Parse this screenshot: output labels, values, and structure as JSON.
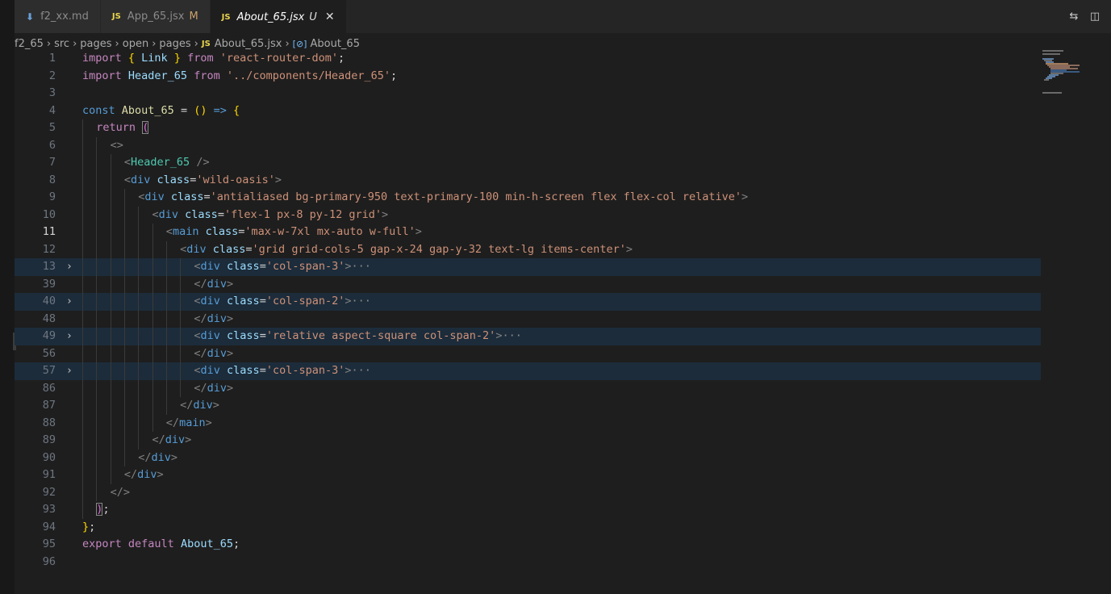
{
  "tabs": [
    {
      "icon": "markdown-file-icon",
      "glyph": "⬇",
      "label": "f2_xx.md",
      "status": "",
      "active": false
    },
    {
      "icon": "js-file-icon",
      "glyph": "JS",
      "label": "App_65.jsx",
      "status": "M",
      "active": false
    },
    {
      "icon": "js-file-icon",
      "glyph": "JS",
      "label": "About_65.jsx",
      "status": "U",
      "active": true,
      "close": "✕"
    }
  ],
  "actions": [
    {
      "icon": "compare-changes-icon",
      "glyph": "⇆"
    },
    {
      "icon": "split-editor-icon",
      "glyph": "◫"
    }
  ],
  "breadcrumb": {
    "separator": "›",
    "folders": [
      "f2_65",
      "src",
      "pages",
      "open",
      "pages"
    ],
    "file_icon": "JS",
    "file": "About_65.jsx",
    "symbol_icon": "[⊘]",
    "symbol": "About_65"
  },
  "editor": {
    "current_line": "11",
    "lines": [
      {
        "n": "1",
        "indent": 0,
        "fold": false,
        "tokens": [
          [
            "kw2",
            "import "
          ],
          [
            "br1",
            "{ "
          ],
          [
            "var",
            "Link"
          ],
          [
            "br1",
            " }"
          ],
          [
            "kw2",
            " from "
          ],
          [
            "str",
            "'react-router-dom'"
          ],
          [
            "punc",
            ";"
          ]
        ]
      },
      {
        "n": "2",
        "indent": 0,
        "fold": false,
        "tokens": [
          [
            "kw2",
            "import "
          ],
          [
            "var",
            "Header_65"
          ],
          [
            "kw2",
            " from "
          ],
          [
            "str",
            "'../components/Header_65'"
          ],
          [
            "punc",
            ";"
          ]
        ]
      },
      {
        "n": "3",
        "indent": 0,
        "fold": false,
        "tokens": []
      },
      {
        "n": "4",
        "indent": 0,
        "fold": false,
        "tokens": [
          [
            "kw",
            "const "
          ],
          [
            "fn",
            "About_65"
          ],
          [
            "punc",
            " = "
          ],
          [
            "br1",
            "()"
          ],
          [
            "kw",
            " => "
          ],
          [
            "br1",
            "{"
          ]
        ]
      },
      {
        "n": "5",
        "indent": 1,
        "fold": false,
        "tokens": [
          [
            "kw2",
            "return "
          ],
          [
            "br2",
            "(",
            "boxed"
          ]
        ]
      },
      {
        "n": "6",
        "indent": 2,
        "fold": false,
        "tokens": [
          [
            "tagb",
            "<>"
          ]
        ]
      },
      {
        "n": "7",
        "indent": 3,
        "fold": false,
        "tokens": [
          [
            "tagb",
            "<"
          ],
          [
            "comp",
            "Header_65"
          ],
          [
            "tagb",
            " />"
          ]
        ]
      },
      {
        "n": "8",
        "indent": 3,
        "fold": false,
        "tokens": [
          [
            "tagb",
            "<"
          ],
          [
            "tag",
            "div"
          ],
          [
            "attr",
            " class"
          ],
          [
            "punc",
            "="
          ],
          [
            "str",
            "'wild-oasis'"
          ],
          [
            "tagb",
            ">"
          ]
        ]
      },
      {
        "n": "9",
        "indent": 4,
        "fold": false,
        "tokens": [
          [
            "tagb",
            "<"
          ],
          [
            "tag",
            "div"
          ],
          [
            "attr",
            " class"
          ],
          [
            "punc",
            "="
          ],
          [
            "str",
            "'antialiased bg-primary-950 text-primary-100 min-h-screen flex flex-col relative'"
          ],
          [
            "tagb",
            ">"
          ]
        ]
      },
      {
        "n": "10",
        "indent": 5,
        "fold": false,
        "tokens": [
          [
            "tagb",
            "<"
          ],
          [
            "tag",
            "div"
          ],
          [
            "attr",
            " class"
          ],
          [
            "punc",
            "="
          ],
          [
            "str",
            "'flex-1 px-8 py-12 grid'"
          ],
          [
            "tagb",
            ">"
          ]
        ]
      },
      {
        "n": "11",
        "indent": 6,
        "fold": false,
        "tokens": [
          [
            "tagb",
            "<"
          ],
          [
            "tag",
            "main"
          ],
          [
            "attr",
            " class"
          ],
          [
            "punc",
            "="
          ],
          [
            "str",
            "'max-w-7xl mx-auto w-full'"
          ],
          [
            "tagb",
            ">"
          ]
        ]
      },
      {
        "n": "12",
        "indent": 7,
        "fold": false,
        "tokens": [
          [
            "tagb",
            "<"
          ],
          [
            "tag",
            "div"
          ],
          [
            "attr",
            " class"
          ],
          [
            "punc",
            "="
          ],
          [
            "str",
            "'grid grid-cols-5 gap-x-24 gap-y-32 text-lg items-center'"
          ],
          [
            "tagb",
            ">"
          ]
        ]
      },
      {
        "n": "13",
        "indent": 8,
        "fold": true,
        "tokens": [
          [
            "tagb",
            "<"
          ],
          [
            "tag",
            "div"
          ],
          [
            "attr",
            " class"
          ],
          [
            "punc",
            "="
          ],
          [
            "str",
            "'col-span-3'"
          ],
          [
            "tagb",
            ">"
          ],
          [
            "ell",
            "···"
          ]
        ]
      },
      {
        "n": "39",
        "indent": 8,
        "fold": false,
        "tokens": [
          [
            "tagb",
            "</"
          ],
          [
            "tag",
            "div"
          ],
          [
            "tagb",
            ">"
          ]
        ]
      },
      {
        "n": "40",
        "indent": 8,
        "fold": true,
        "tokens": [
          [
            "tagb",
            "<"
          ],
          [
            "tag",
            "div"
          ],
          [
            "attr",
            " class"
          ],
          [
            "punc",
            "="
          ],
          [
            "str",
            "'col-span-2'"
          ],
          [
            "tagb",
            ">"
          ],
          [
            "ell",
            "···"
          ]
        ]
      },
      {
        "n": "48",
        "indent": 8,
        "fold": false,
        "tokens": [
          [
            "tagb",
            "</"
          ],
          [
            "tag",
            "div"
          ],
          [
            "tagb",
            ">"
          ]
        ]
      },
      {
        "n": "49",
        "indent": 8,
        "fold": true,
        "tokens": [
          [
            "tagb",
            "<"
          ],
          [
            "tag",
            "div"
          ],
          [
            "attr",
            " class"
          ],
          [
            "punc",
            "="
          ],
          [
            "str",
            "'relative aspect-square col-span-2'"
          ],
          [
            "tagb",
            ">"
          ],
          [
            "ell",
            "···"
          ]
        ]
      },
      {
        "n": "56",
        "indent": 8,
        "fold": false,
        "tokens": [
          [
            "tagb",
            "</"
          ],
          [
            "tag",
            "div"
          ],
          [
            "tagb",
            ">"
          ]
        ]
      },
      {
        "n": "57",
        "indent": 8,
        "fold": true,
        "tokens": [
          [
            "tagb",
            "<"
          ],
          [
            "tag",
            "div"
          ],
          [
            "attr",
            " class"
          ],
          [
            "punc",
            "="
          ],
          [
            "str",
            "'col-span-3'"
          ],
          [
            "tagb",
            ">"
          ],
          [
            "ell",
            "···"
          ]
        ]
      },
      {
        "n": "86",
        "indent": 8,
        "fold": false,
        "tokens": [
          [
            "tagb",
            "</"
          ],
          [
            "tag",
            "div"
          ],
          [
            "tagb",
            ">"
          ]
        ]
      },
      {
        "n": "87",
        "indent": 7,
        "fold": false,
        "tokens": [
          [
            "tagb",
            "</"
          ],
          [
            "tag",
            "div"
          ],
          [
            "tagb",
            ">"
          ]
        ]
      },
      {
        "n": "88",
        "indent": 6,
        "fold": false,
        "tokens": [
          [
            "tagb",
            "</"
          ],
          [
            "tag",
            "main"
          ],
          [
            "tagb",
            ">"
          ]
        ]
      },
      {
        "n": "89",
        "indent": 5,
        "fold": false,
        "tokens": [
          [
            "tagb",
            "</"
          ],
          [
            "tag",
            "div"
          ],
          [
            "tagb",
            ">"
          ]
        ]
      },
      {
        "n": "90",
        "indent": 4,
        "fold": false,
        "tokens": [
          [
            "tagb",
            "</"
          ],
          [
            "tag",
            "div"
          ],
          [
            "tagb",
            ">"
          ]
        ]
      },
      {
        "n": "91",
        "indent": 3,
        "fold": false,
        "tokens": [
          [
            "tagb",
            "</"
          ],
          [
            "tag",
            "div"
          ],
          [
            "tagb",
            ">"
          ]
        ]
      },
      {
        "n": "92",
        "indent": 2,
        "fold": false,
        "tokens": [
          [
            "tagb",
            "</>"
          ]
        ]
      },
      {
        "n": "93",
        "indent": 1,
        "fold": false,
        "tokens": [
          [
            "br2",
            ")",
            "boxed"
          ],
          [
            "punc",
            ";"
          ]
        ]
      },
      {
        "n": "94",
        "indent": 0,
        "fold": false,
        "tokens": [
          [
            "br1",
            "}"
          ],
          [
            "punc",
            ";"
          ]
        ]
      },
      {
        "n": "95",
        "indent": 0,
        "fold": false,
        "tokens": [
          [
            "kw2",
            "export "
          ],
          [
            "kw2",
            "default "
          ],
          [
            "var",
            "About_65"
          ],
          [
            "punc",
            ";"
          ]
        ]
      },
      {
        "n": "96",
        "indent": 0,
        "fold": false,
        "tokens": []
      }
    ]
  },
  "colors": {
    "background": "#1e1e1e",
    "folded_line_bg": "#1c2c3b",
    "js_icon": "#e8d44d",
    "modified": "#c9a26b"
  }
}
